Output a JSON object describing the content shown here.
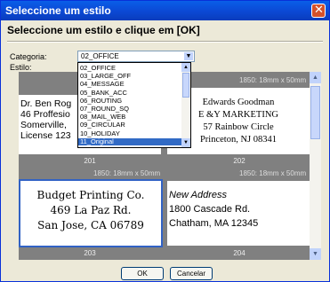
{
  "window": {
    "title": "Seleccione um estilo",
    "close_symbol": "✕"
  },
  "header": "Seleccione um estilo e clique em [OK]",
  "categoria": {
    "label": "Categoria:",
    "value": "02_OFFICE",
    "arrow": "▼"
  },
  "estilo_label": "Estilo:",
  "dropdown_items": [
    "02_OFFICE",
    "03_LARGE_OFF",
    "04_MESSAGE",
    "05_BANK_ACC",
    "06_ROUTING",
    "07_ROUND_SQ",
    "08_MAIL_WEB",
    "09_CIRCULAR",
    "10_HOLIDAY",
    "11_Original"
  ],
  "selected_index": 9,
  "scroll_symbols": {
    "up": "▲",
    "down": "▼"
  },
  "styles": [
    {
      "size": "",
      "number": "201",
      "lines": [
        "Dr. Ben Rog",
        "46 Proffesio",
        "Somerville,",
        "License 123"
      ]
    },
    {
      "size": "1850: 18mm x 50mm",
      "number": "202",
      "lines": [
        "Edwards Goodman",
        "E &Y MARKETING",
        "57 Rainbow Circle",
        "Princeton, NJ 08341"
      ]
    },
    {
      "size": "1850: 18mm x 50mm",
      "number": "203",
      "lines": [
        "Budget Printing Co.",
        "469 La Paz Rd.",
        "San Jose, CA 06789"
      ]
    },
    {
      "size": "1850: 18mm x 50mm",
      "number": "204",
      "lines": [
        "New Address",
        "1800 Cascade Rd.",
        "Chatham, MA 12345"
      ]
    }
  ],
  "buttons": {
    "ok": "OK",
    "cancel": "Cancelar"
  }
}
